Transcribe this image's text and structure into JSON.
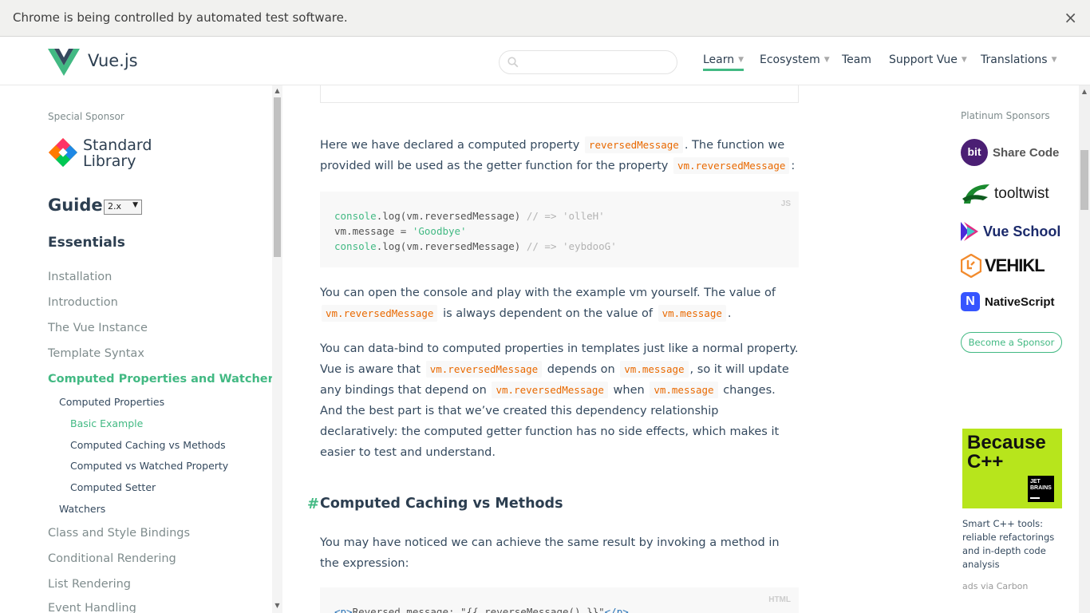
{
  "infobar": {
    "message": "Chrome is being controlled by automated test software.",
    "close_label": "×"
  },
  "header": {
    "brand": "Vue.js",
    "search": {
      "value": "",
      "placeholder": ""
    },
    "nav": [
      {
        "label": "Learn",
        "has_caret": true,
        "active": true
      },
      {
        "label": "Ecosystem",
        "has_caret": true
      },
      {
        "label": "Team",
        "has_caret": false
      },
      {
        "label": "Support Vue",
        "has_caret": true
      },
      {
        "label": "Translations",
        "has_caret": true
      }
    ],
    "caret": "▼"
  },
  "sidebar": {
    "special_sponsor_label": "Special Sponsor",
    "sponsor_line1": "Standard",
    "sponsor_line2": "Library",
    "guide_title": "Guide",
    "version": "2.x",
    "section": "Essentials",
    "links": [
      {
        "label": "Installation"
      },
      {
        "label": "Introduction"
      },
      {
        "label": "The Vue Instance"
      },
      {
        "label": "Template Syntax"
      },
      {
        "label": "Computed Properties and Watchers",
        "active": true
      },
      {
        "label": "Class and Style Bindings"
      },
      {
        "label": "Conditional Rendering"
      },
      {
        "label": "List Rendering"
      },
      {
        "label": "Event Handling"
      }
    ],
    "sub_links": [
      {
        "label": "Computed Properties"
      },
      {
        "label": "Watchers"
      }
    ],
    "subsub_links": [
      {
        "label": "Basic Example",
        "active": true
      },
      {
        "label": "Computed Caching vs Methods"
      },
      {
        "label": "Computed vs Watched Property"
      },
      {
        "label": "Computed Setter"
      }
    ]
  },
  "content": {
    "p1": {
      "t1": "Here we have declared a computed property ",
      "c1": "reversedMessage",
      "t2": ". The function we provided will be used as the getter function for the property ",
      "c2": "vm.reversedMessage",
      "t3": ":"
    },
    "code1": {
      "lang": "JS",
      "line1": {
        "a": "console",
        "b": ".log(vm.reversedMessage) ",
        "c": "// => 'olleH'"
      },
      "line2": {
        "a": "vm.message = ",
        "b": "'Goodbye'"
      },
      "line3": {
        "a": "console",
        "b": ".log(vm.reversedMessage) ",
        "c": "// => 'eybdooG'"
      }
    },
    "p2": {
      "t1": "You can open the console and play with the example vm yourself. The value of ",
      "c1": "vm.reversedMessage",
      "t2": " is always dependent on the value of ",
      "c2": "vm.message",
      "t3": "."
    },
    "p3": {
      "t1": "You can data-bind to computed properties in templates just like a normal property. Vue is aware that ",
      "c1": "vm.reversedMessage",
      "t2": " depends on ",
      "c2": "vm.message",
      "t3": ", so it will update any bindings that depend on ",
      "c3": "vm.reversedMessage",
      "t4": " when ",
      "c4": "vm.message",
      "t5": " changes. And the best part is that we’ve created this dependency relationship declaratively: the computed getter function has no side effects, which makes it easier to test and understand."
    },
    "section_hash": "#",
    "section_title": "Computed Caching vs Methods",
    "p4": "You may have noticed we can achieve the same result by invoking a method in the expression:",
    "code2": {
      "lang": "HTML",
      "tag_open": "<p>",
      "text": "Reversed message: \"{{ reverseMessage() }}\"",
      "tag_close": "</p>"
    }
  },
  "right": {
    "platinum_label": "Platinum Sponsors",
    "sponsors": [
      {
        "name": "Share Code",
        "badge": "bit"
      },
      {
        "name": "tooltwist"
      },
      {
        "name": "Vue School"
      },
      {
        "name": "VEHIKL"
      },
      {
        "name": "NativeScript"
      }
    ],
    "become_sponsor": "Become a Sponsor",
    "ad": {
      "headline_line1": "Because",
      "headline_line2": "C++",
      "brand_line1": "JET",
      "brand_line2": "BRAINS",
      "text": "Smart C++ tools: reliable refactorings and in-depth code analysis",
      "via": "ads via Carbon"
    }
  },
  "colors": {
    "accent": "#42b983",
    "text": "#34495e",
    "inline_code": "#e96900",
    "ad_bg": "#b7e51c"
  }
}
